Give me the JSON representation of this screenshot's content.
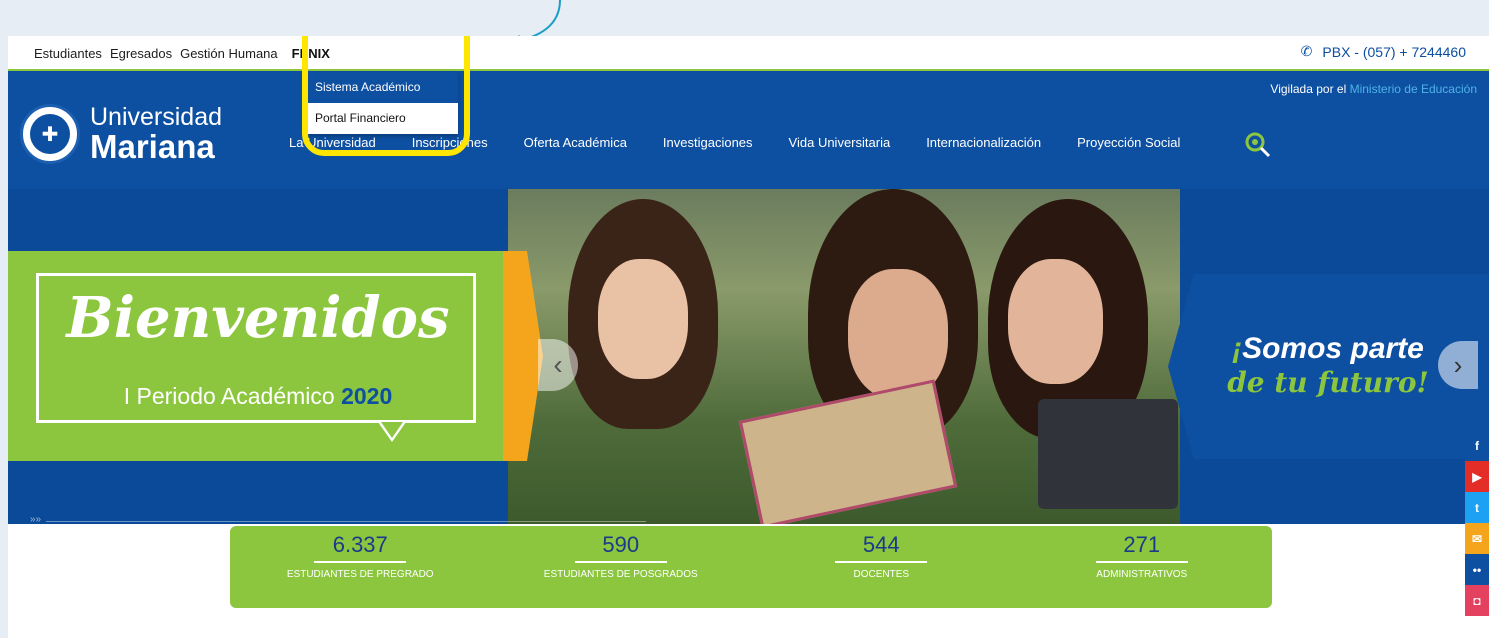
{
  "topbar": {
    "links": [
      "Estudiantes",
      "Egresados",
      "Gestión Humana",
      "FÉNIX"
    ],
    "phone": "PBX - (057) + 7244460"
  },
  "dropdown": {
    "items": [
      "Sistema Académico",
      "Portal Financiero"
    ],
    "active_index": 0
  },
  "header": {
    "logo_line1": "Universidad",
    "logo_line2": "Mariana",
    "vigilada_prefix": "Vigilada por el",
    "vigilada_ministry": "Ministerio de Educación",
    "nav": [
      "La Universidad",
      "Inscripciones",
      "Oferta Académica",
      "Investigaciones",
      "Vida Universitaria",
      "Internacionalización",
      "Proyección Social"
    ]
  },
  "banner": {
    "title": "Bienvenidos",
    "subtitle_prefix": "I Periodo Académico",
    "subtitle_year": "2020",
    "right_line1": "Somos parte",
    "right_line2": "de tu futuro",
    "excl_open": "¡",
    "excl_close": "!"
  },
  "stats": [
    {
      "value": "6.337",
      "label": "ESTUDIANTES DE PREGRADO"
    },
    {
      "value": "590",
      "label": "ESTUDIANTES DE POSGRADOS"
    },
    {
      "value": "544",
      "label": "DOCENTES"
    },
    {
      "value": "271",
      "label": "ADMINISTRATIVOS"
    }
  ],
  "social": [
    {
      "icon": "facebook-icon",
      "glyph": "f",
      "color": "#0d4fa0"
    },
    {
      "icon": "youtube-icon",
      "glyph": "▶",
      "color": "#e52d27"
    },
    {
      "icon": "twitter-icon",
      "glyph": "t",
      "color": "#1da1f2"
    },
    {
      "icon": "email-icon",
      "glyph": "✉",
      "color": "#f4a51c"
    },
    {
      "icon": "flickr-icon",
      "glyph": "••",
      "color": "#0d4fa0"
    },
    {
      "icon": "instagram-icon",
      "glyph": "◘",
      "color": "#e4405f"
    }
  ],
  "colors": {
    "brand_blue": "#0d4fa0",
    "brand_green": "#8cc63f",
    "highlight_yellow": "#ffe600",
    "orange": "#f4a51c"
  }
}
